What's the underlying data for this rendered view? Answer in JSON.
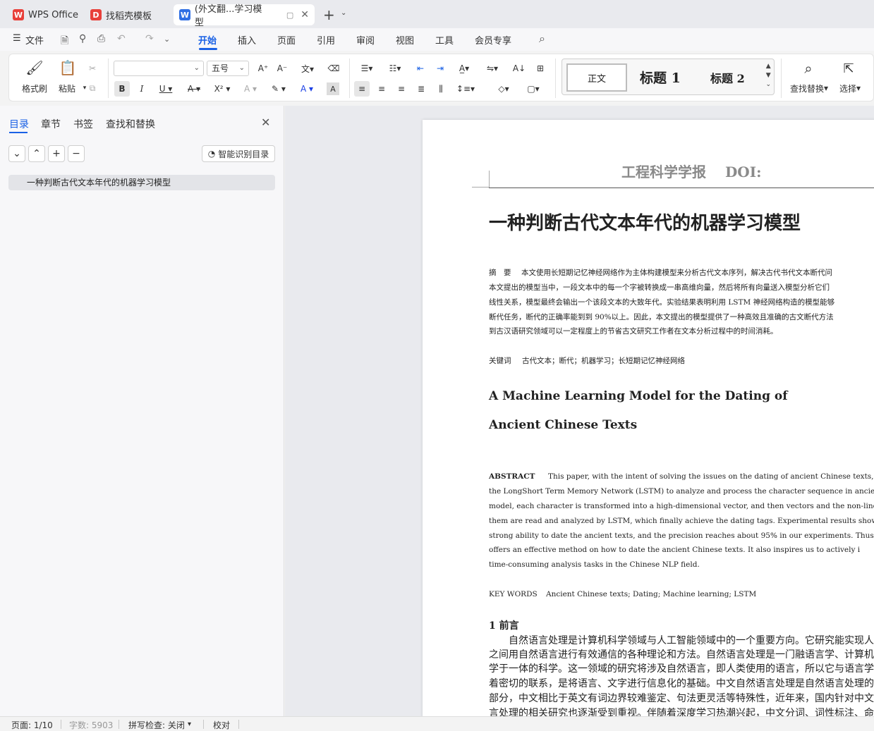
{
  "tabs": {
    "wps": "WPS Office",
    "template": "找稻壳模板",
    "doc": "(外文翻...学习模型"
  },
  "menu": {
    "file": "文件",
    "items": [
      "开始",
      "插入",
      "页面",
      "引用",
      "审阅",
      "视图",
      "工具",
      "会员专享"
    ]
  },
  "ribbon": {
    "format_painter": "格式刷",
    "paste": "粘贴",
    "font_size": "五号",
    "styles": {
      "normal": "正文",
      "h1": "标题 1",
      "h2": "标题 2"
    },
    "find_replace": "查找替换",
    "select": "选择"
  },
  "sidebar": {
    "tabs": [
      "目录",
      "章节",
      "书签",
      "查找和替换"
    ],
    "smart_toc": "智能识别目录",
    "toc_item": "一种判断古代文本年代的机器学习模型"
  },
  "document": {
    "header": "工程科学学报　 DOI:",
    "title": "一种判断古代文本年代的机器学习模型",
    "abstract_cn_label": "摘　要",
    "abstract_cn_lines": [
      "本文使用长短期记忆神经网络作为主体构建模型来分析古代文本序列，解决古代书代文本断代问",
      "本文提出的模型当中，一段文本中的每一个字被转换成一串高维向量，然后将所有向量送入模型分析它们",
      "线性关系，模型最终会输出一个该段文本的大致年代。实验结果表明利用 LSTM 神经网络构造的模型能够",
      "断代任务，断代的正确率能到到 90%以上。因此，本文提出的模型提供了一种高效且准确的古文断代方法",
      "到古汉语研究领域可以一定程度上的节省古文研究工作者在文本分析过程中的时间消耗。"
    ],
    "keywords_cn_label": "关键词",
    "keywords_cn": "古代文本；断代；机器学习；长短期记忆神经网络",
    "title_en_1": "A Machine Learning Model for the Dating of",
    "title_en_2": "Ancient Chinese Texts",
    "abstract_en_label": "ABSTRACT",
    "abstract_en_lines": [
      "This paper, with the intent of solving the issues on the dating of ancient Chinese texts, takes a",
      "the LongShort Term Memory Network (LSTM) to analyze and process the character sequence in ancient Chin",
      "model, each character is transformed into a high-dimensional vector, and then vectors and the non-linear relations",
      "them are read and analyzed by LSTM, which finally achieve the dating tags. Experimental results show that the L",
      "strong ability to date the ancient texts, and the precision reaches about 95% in our experiments. Thus, the prop",
      "offers  an  effective  method  on  how  to  date  the  ancient  Chinese  texts.  It  also  inspires  us  to  actively  i",
      "time-consuming analysis tasks in the Chinese NLP field."
    ],
    "keywords_en_label": "KEY WORDS",
    "keywords_en": "Ancient Chinese texts; Dating; Machine learning; LSTM",
    "section1_title": "1  前言",
    "section1_lines": [
      "自然语言处理是计算机科学领域与人工智能领域中的一个重要方向。它研究能实现人",
      "之间用自然语言进行有效通信的各种理论和方法。自然语言处理是一门融语言学、计算机",
      "学于一体的科学。这一领域的研究将涉及自然语言，即人类使用的语言，所以它与语言学",
      "着密切的联系，是将语言、文字进行信息化的基础。中文自然语言处理是自然语言处理的",
      "部分，中文相比于英文有词边界较难鉴定、句法更灵活等特殊性，近年来，国内针对中文",
      "言处理的相关研究也逐渐受到重视。伴随着深度学习热潮兴起，中文分词、词性标注、命"
    ]
  },
  "status": {
    "page": "页面: 1/10",
    "words": "字数: 5903",
    "spell": "拼写检查: 关闭",
    "proof": "校对"
  },
  "colors": {
    "accent": "#1a61e5",
    "wps_red": "#e8403a",
    "doc_blue": "#2f6fe4"
  }
}
